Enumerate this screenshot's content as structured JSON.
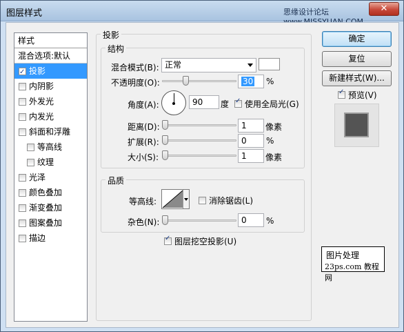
{
  "window": {
    "title": "图层样式",
    "watermark": "思缘设计论坛 www.MISSYUAN.COM",
    "close_icon": "close-icon"
  },
  "styles_list": {
    "header": "样式",
    "blend_options": "混合选项:默认",
    "items": [
      {
        "label": "投影",
        "checked": true,
        "selected": true,
        "sub": false
      },
      {
        "label": "内阴影",
        "checked": false,
        "selected": false,
        "sub": false
      },
      {
        "label": "外发光",
        "checked": false,
        "selected": false,
        "sub": false
      },
      {
        "label": "内发光",
        "checked": false,
        "selected": false,
        "sub": false
      },
      {
        "label": "斜面和浮雕",
        "checked": false,
        "selected": false,
        "sub": false
      },
      {
        "label": "等高线",
        "checked": false,
        "selected": false,
        "sub": true
      },
      {
        "label": "纹理",
        "checked": false,
        "selected": false,
        "sub": true
      },
      {
        "label": "光泽",
        "checked": false,
        "selected": false,
        "sub": false
      },
      {
        "label": "颜色叠加",
        "checked": false,
        "selected": false,
        "sub": false
      },
      {
        "label": "渐变叠加",
        "checked": false,
        "selected": false,
        "sub": false
      },
      {
        "label": "图案叠加",
        "checked": false,
        "selected": false,
        "sub": false
      },
      {
        "label": "描边",
        "checked": false,
        "selected": false,
        "sub": false
      }
    ]
  },
  "drop_shadow": {
    "title": "投影",
    "structure": {
      "title": "结构",
      "blend_mode_label": "混合模式(B):",
      "blend_mode_value": "正常",
      "shadow_color": "#ffffff",
      "opacity_label": "不透明度(O):",
      "opacity_value": "30",
      "opacity_unit": "%",
      "opacity_level": 0.3,
      "angle_label": "角度(A):",
      "angle_value": "90",
      "angle_unit": "度",
      "global_light_label": "使用全局光(G)",
      "global_light_checked": true,
      "distance_label": "距离(D):",
      "distance_value": "1",
      "distance_unit": "像素",
      "spread_label": "扩展(R):",
      "spread_value": "0",
      "spread_unit": "%",
      "size_label": "大小(S):",
      "size_value": "1",
      "size_unit": "像素"
    },
    "quality": {
      "title": "品质",
      "contour_label": "等高线:",
      "anti_alias_label": "消除锯齿(L)",
      "anti_alias_checked": false,
      "noise_label": "杂色(N):",
      "noise_value": "0",
      "noise_unit": "%"
    },
    "knockout_label": "图层挖空投影(U)",
    "knockout_checked": true
  },
  "buttons": {
    "ok": "确定",
    "reset": "复位",
    "new_style": "新建样式(W)...",
    "preview_label": "预览(V)",
    "preview_checked": true
  },
  "logo": {
    "line1": "图片处理",
    "line2": "23ps.com 教程网"
  }
}
